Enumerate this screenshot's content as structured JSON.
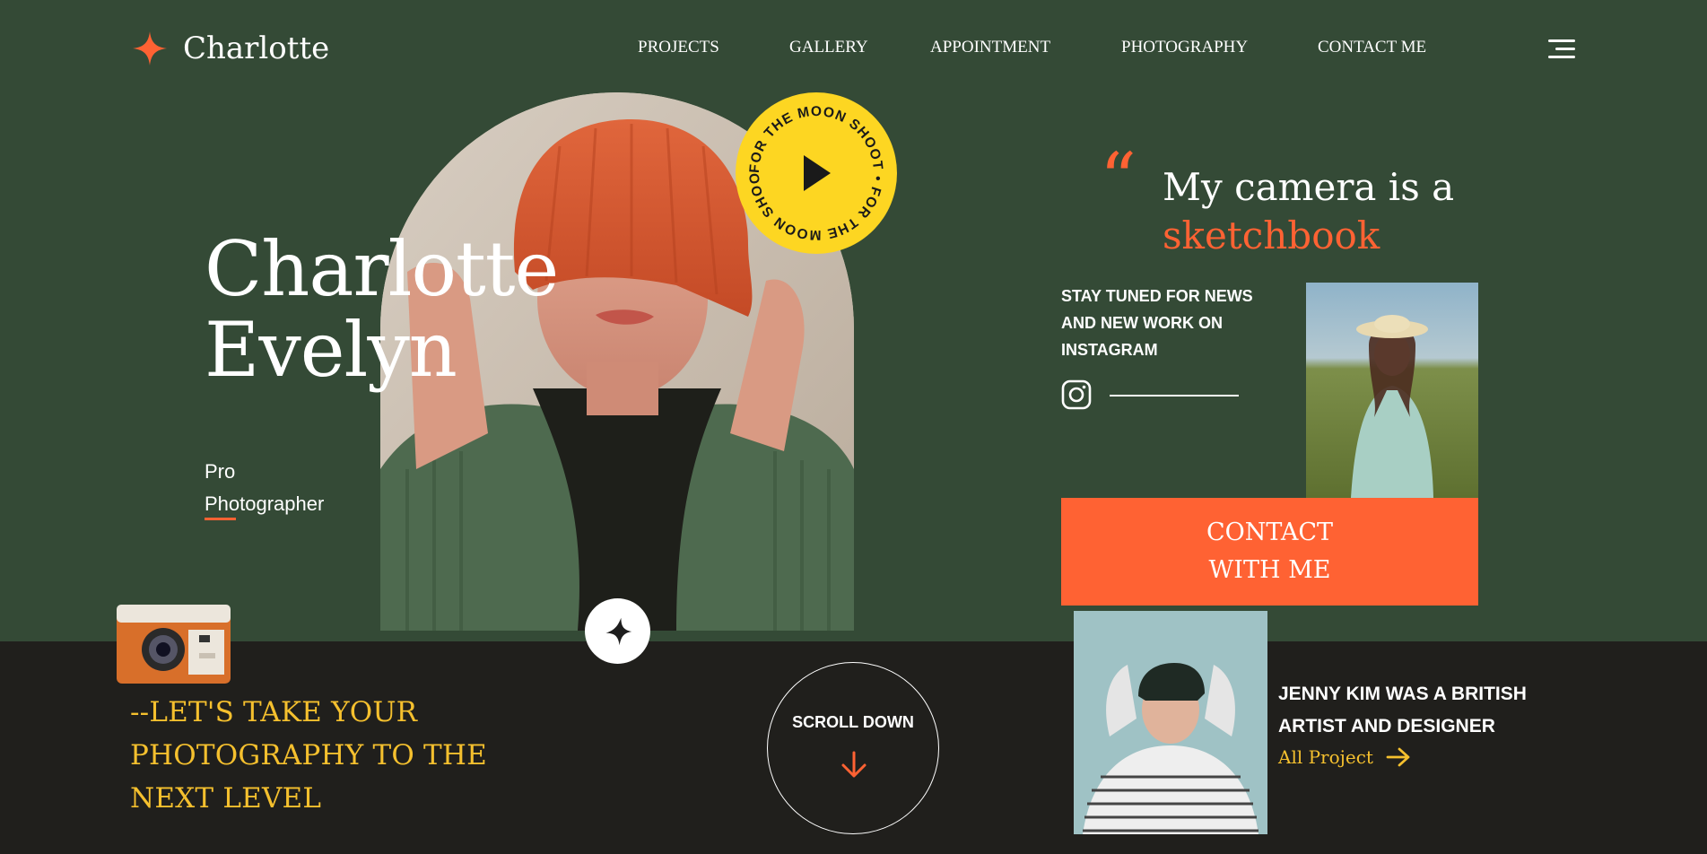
{
  "brand": {
    "name": "Charlotte",
    "accent": "#ff6233",
    "yellow": "#fdd622",
    "green": "#344a36",
    "dark": "#201f1c"
  },
  "nav": {
    "items": [
      {
        "label": "PROJECTS"
      },
      {
        "label": "GALLERY"
      },
      {
        "label": "APPOINTMENT"
      },
      {
        "label": "PHOTOGRAPHY"
      },
      {
        "label": "CONTACT ME"
      }
    ]
  },
  "hero": {
    "name_line1": "Charlotte",
    "name_line2": "Evelyn",
    "role_line1": "Pro",
    "role_line2": "Photographer",
    "badge_text": "FOR THE MOON SHOOT • FOR THE MOON SHOOT • "
  },
  "quote": {
    "line1": "My camera is a",
    "line2": "sketchbook",
    "mark": "“"
  },
  "social": {
    "stay_tuned": "STAY TUNED FOR NEWS AND NEW WORK ON INSTAGRAM",
    "icon": "instagram-icon"
  },
  "contact": {
    "line1": "CONTACT",
    "line2": "WITH ME"
  },
  "footer": {
    "cta_line1": "--LET'S TAKE YOUR",
    "cta_line2": "PHOTOGRAPHY TO THE",
    "cta_line3": "NEXT LEVEL",
    "scroll_label": "SCROLL DOWN",
    "jenny_line1": "JENNY KIM WAS A BRITISH",
    "jenny_line2": "ARTIST AND DESIGNER",
    "all_project": "All Project"
  }
}
